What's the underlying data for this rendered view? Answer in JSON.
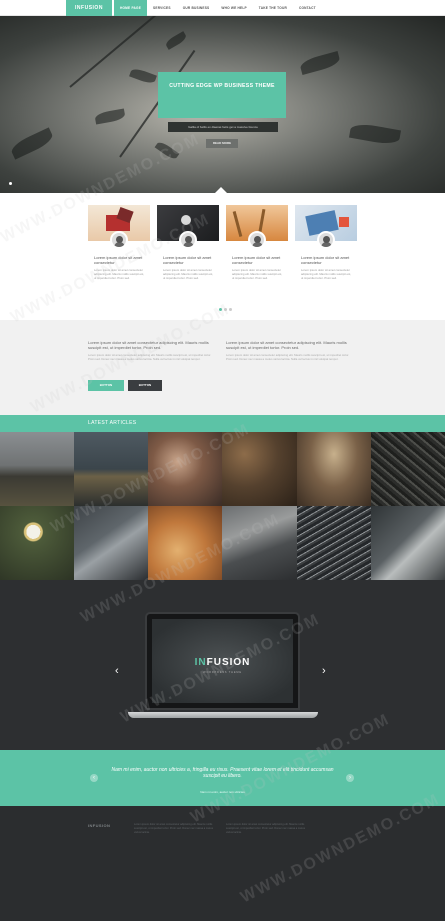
{
  "nav": {
    "logo": "INFUSION",
    "items": [
      "HOME PAGE",
      "SERVICES",
      "OUR BUSINESS",
      "WHO WE HELP",
      "TAKE THE TOUR",
      "CONTACT"
    ],
    "active_index": 0
  },
  "hero": {
    "title": "CUTTING EDGE WP BUSINESS THEME",
    "subtitle": "Gallia of bellis ex diaeras facis get a massive licence",
    "button": "READ MORE"
  },
  "cards": [
    {
      "title": "Lorem ipsum dolor sit amet consectetur",
      "text": "Lorem ipsum dolor sit amet consectetur adipiscing elit. Mauris mollis suscipit est, ut imperdiet tortor. Proin sed."
    },
    {
      "title": "Lorem ipsum dolor sit amet consectetur",
      "text": "Lorem ipsum dolor sit amet consectetur adipiscing elit. Mauris mollis suscipit est, ut imperdiet tortor. Proin sed."
    },
    {
      "title": "Lorem ipsum dolor sit amet consectetur",
      "text": "Lorem ipsum dolor sit amet consectetur adipiscing elit. Mauris mollis suscipit est, ut imperdiet tortor. Proin sed."
    },
    {
      "title": "Lorem ipsum dolor sit amet consectetur",
      "text": "Lorem ipsum dolor sit amet consectetur adipiscing elit. Mauris mollis suscipit est, ut imperdiet tortor. Proin sed."
    }
  ],
  "intro": {
    "left_heading": "Lorem ipsum dolor sit amet consectetur adipiscing elit. Mauris mollis suscipit est, ut imperdiet tortor. Proin sed.",
    "left_text": "Lorem ipsum dolor sit amet consectetur adipiscing elit. Mauris mollis suscipit est, ut imperdiet tortor. Proin sed. Donec nec massa a metus varius lacinia. Nulla vel lectus in nisl volutpat tempor.",
    "right_heading": "Lorem ipsum dolor sit amet consectetur adipiscing elit. Mauris mollis suscipit est, ut imperdiet tortor. Proin sed.",
    "right_text": "Lorem ipsum dolor sit amet consectetur adipiscing elit. Mauris mollis suscipit est, ut imperdiet tortor. Proin sed. Donec nec massa a metus varius lacinia. Nulla vel lectus in nisl volutpat tempor.",
    "button_primary": "BUTTON",
    "button_secondary": "BUTTON"
  },
  "articles": {
    "heading": "LATEST ARTICLES"
  },
  "showcase": {
    "brand_accent": "IN",
    "brand_rest": "FUSION",
    "brand_sub": "WORDPRESS THEME"
  },
  "quote": {
    "text": "Nam mi enim, auctor non ultricies a, fringilla eu risus. Praesent vitae lorem et elit tincidunt accumsan suscipit eu libero.",
    "author": "Nam mi enim, auctor non ultricies"
  },
  "footer": {
    "logo": "INFUSION",
    "col1": "Lorem ipsum dolor sit amet consectetur adipiscing elit. Mauris mollis suscipit est, ut imperdiet tortor. Proin sed. Donec nec massa a metus varius lacinia.",
    "col2": "Lorem ipsum dolor sit amet consectetur adipiscing elit. Mauris mollis suscipit est, ut imperdiet tortor. Proin sed. Donec nec massa a metus varius lacinia."
  },
  "watermark": "WWW.DOWNDEMO.COM",
  "colors": {
    "accent": "#5cc3a6",
    "dark": "#2d2f31",
    "footer": "#2b2d2f"
  }
}
